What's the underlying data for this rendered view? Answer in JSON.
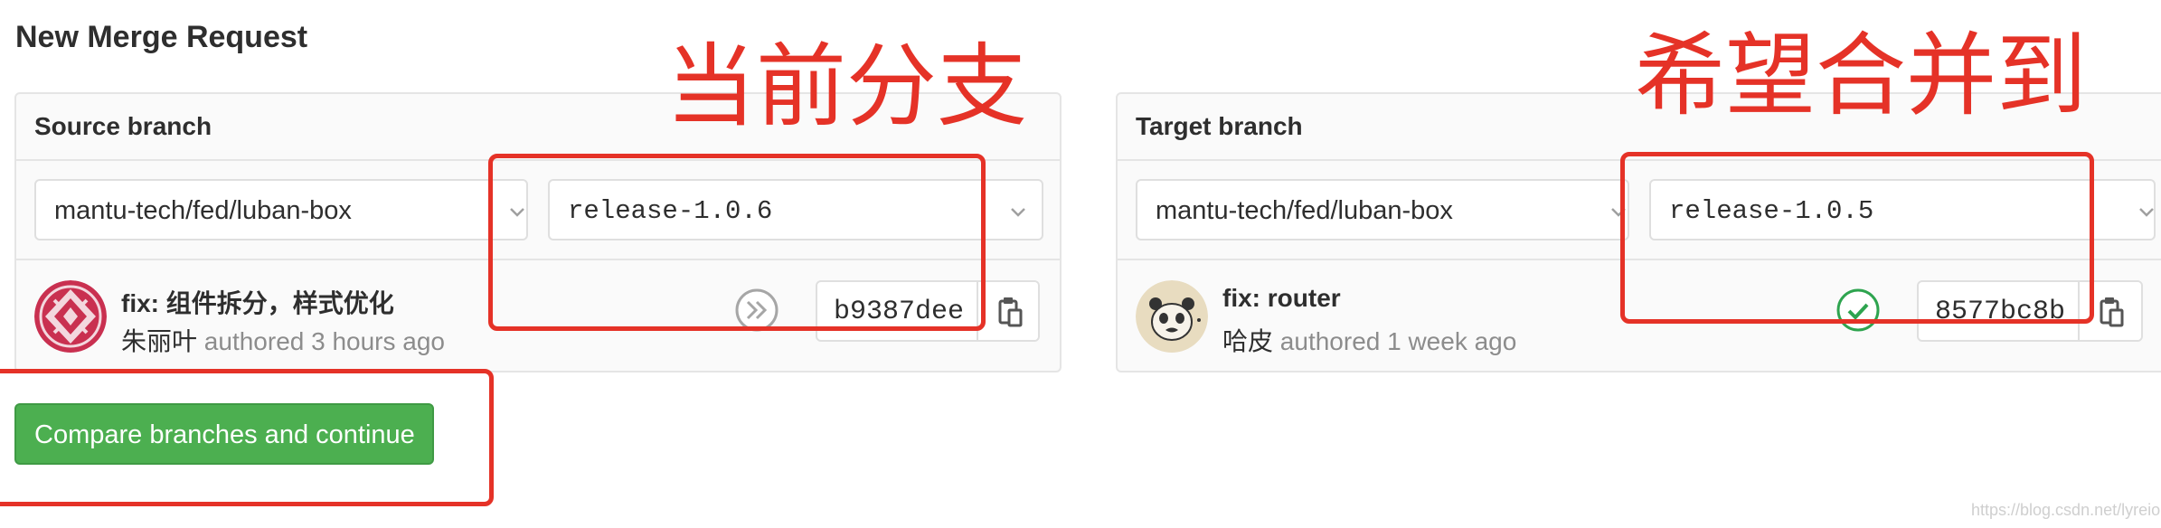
{
  "page": {
    "title": "New Merge Request"
  },
  "source": {
    "label": "Source branch",
    "project": "mantu-tech/fed/luban-box",
    "branch": "release-1.0.6",
    "commit": {
      "title": "fix: 组件拆分，样式优化",
      "author": "朱丽叶",
      "meta": " authored 3 hours ago",
      "sha": "b9387dee",
      "status_icon": "pipeline-skipped-icon"
    }
  },
  "target": {
    "label": "Target branch",
    "project": "mantu-tech/fed/luban-box",
    "branch": "release-1.0.5",
    "commit": {
      "title": "fix: router",
      "author": "哈皮",
      "meta": " authored 1 week ago",
      "sha": "8577bc8b",
      "status_icon": "pipeline-passed-icon"
    }
  },
  "actions": {
    "compare": "Compare branches and continue"
  },
  "annotations": {
    "source_note": "当前分支",
    "target_note": "希望合并到"
  },
  "watermark": "https://blog.csdn.net/lyreion",
  "colors": {
    "annotation": "#e53227",
    "primary_button": "#4caf50",
    "success": "#2ea44f"
  }
}
